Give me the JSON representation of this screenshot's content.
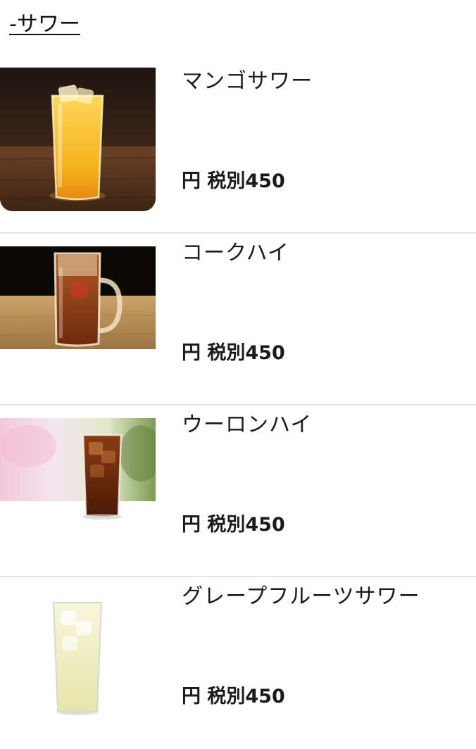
{
  "section": {
    "title": "-サワー"
  },
  "menu": {
    "items": [
      {
        "name": "マンゴサワー",
        "price": "円 税別450",
        "image_icon": "mango-sour-glass-photo"
      },
      {
        "name": "コークハイ",
        "price": "円 税別450",
        "image_icon": "coke-highball-mug-photo"
      },
      {
        "name": "ウーロンハイ",
        "price": "円 税別450",
        "image_icon": "oolong-highball-glass-photo"
      },
      {
        "name": "グレープフルーツサワー",
        "price": "円 税別450",
        "image_icon": "grapefruit-sour-glass-photo"
      }
    ]
  },
  "colors": {
    "divider": "#e3e3e3",
    "text": "#1a1a1a",
    "mango_drink": "#f2b320",
    "cola_drink": "#8a3a12",
    "oolong_drink": "#6b2d0c",
    "grapefruit_drink": "#efeec4"
  }
}
